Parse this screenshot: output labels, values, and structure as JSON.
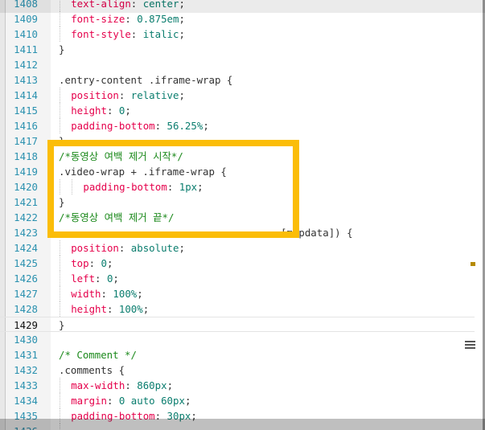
{
  "editor": {
    "language": "css",
    "current_line": "1429",
    "colors": {
      "line_number": "#2b91af",
      "property": "#e5004b",
      "value": "#0a7d6e",
      "comment": "#1d8a1d",
      "highlight_box": "#fbbd08"
    }
  },
  "lines": [
    {
      "n": "1408",
      "indent": 1,
      "tokens": [
        {
          "t": "text-align",
          "k": "prop"
        },
        {
          "t": ": ",
          "k": "pun"
        },
        {
          "t": "center",
          "k": "val"
        },
        {
          "t": ";",
          "k": "pun"
        }
      ]
    },
    {
      "n": "1409",
      "indent": 1,
      "tokens": [
        {
          "t": "font-size",
          "k": "prop"
        },
        {
          "t": ": ",
          "k": "pun"
        },
        {
          "t": "0.875em",
          "k": "val"
        },
        {
          "t": ";",
          "k": "pun"
        }
      ]
    },
    {
      "n": "1410",
      "indent": 1,
      "tokens": [
        {
          "t": "font-style",
          "k": "prop"
        },
        {
          "t": ": ",
          "k": "pun"
        },
        {
          "t": "italic",
          "k": "val"
        },
        {
          "t": ";",
          "k": "pun"
        }
      ]
    },
    {
      "n": "1411",
      "indent": 0,
      "tokens": [
        {
          "t": "}",
          "k": "pun"
        }
      ]
    },
    {
      "n": "1412",
      "indent": 0,
      "tokens": []
    },
    {
      "n": "1413",
      "indent": 0,
      "tokens": [
        {
          "t": ".entry-content .iframe-wrap {",
          "k": "sel"
        }
      ]
    },
    {
      "n": "1414",
      "indent": 1,
      "tokens": [
        {
          "t": "position",
          "k": "prop"
        },
        {
          "t": ": ",
          "k": "pun"
        },
        {
          "t": "relative",
          "k": "val"
        },
        {
          "t": ";",
          "k": "pun"
        }
      ]
    },
    {
      "n": "1415",
      "indent": 1,
      "tokens": [
        {
          "t": "height",
          "k": "prop"
        },
        {
          "t": ": ",
          "k": "pun"
        },
        {
          "t": "0",
          "k": "val"
        },
        {
          "t": ";",
          "k": "pun"
        }
      ]
    },
    {
      "n": "1416",
      "indent": 1,
      "tokens": [
        {
          "t": "padding-bottom",
          "k": "prop"
        },
        {
          "t": ": ",
          "k": "pun"
        },
        {
          "t": "56.25%",
          "k": "val"
        },
        {
          "t": ";",
          "k": "pun"
        }
      ]
    },
    {
      "n": "1417",
      "indent": 0,
      "tokens": [
        {
          "t": "}",
          "k": "pun"
        }
      ]
    },
    {
      "n": "1418",
      "indent": 0,
      "tokens": [
        {
          "t": "/*동영상 여백 제거 시작*/",
          "k": "cmt"
        }
      ]
    },
    {
      "n": "1419",
      "indent": 0,
      "tokens": [
        {
          "t": ".video-wrap + .iframe-wrap {",
          "k": "sel"
        }
      ]
    },
    {
      "n": "1420",
      "indent": 2,
      "tokens": [
        {
          "t": "padding-bottom",
          "k": "prop"
        },
        {
          "t": ": ",
          "k": "pun"
        },
        {
          "t": "1px",
          "k": "val"
        },
        {
          "t": ";",
          "k": "pun"
        }
      ]
    },
    {
      "n": "1421",
      "indent": 0,
      "tokens": [
        {
          "t": "}",
          "k": "pun"
        }
      ]
    },
    {
      "n": "1422",
      "indent": 0,
      "tokens": [
        {
          "t": "/*동영상 여백 제거 끝*/",
          "k": "cmt"
        }
      ]
    },
    {
      "n": "1423",
      "indent": 0,
      "tokens": [
        {
          "t": "                                     [mapdata]) {",
          "k": "sel"
        }
      ]
    },
    {
      "n": "1424",
      "indent": 1,
      "tokens": [
        {
          "t": "position",
          "k": "prop"
        },
        {
          "t": ": ",
          "k": "pun"
        },
        {
          "t": "absolute",
          "k": "val"
        },
        {
          "t": ";",
          "k": "pun"
        }
      ]
    },
    {
      "n": "1425",
      "indent": 1,
      "tokens": [
        {
          "t": "top",
          "k": "prop"
        },
        {
          "t": ": ",
          "k": "pun"
        },
        {
          "t": "0",
          "k": "val"
        },
        {
          "t": ";",
          "k": "pun"
        }
      ]
    },
    {
      "n": "1426",
      "indent": 1,
      "tokens": [
        {
          "t": "left",
          "k": "prop"
        },
        {
          "t": ": ",
          "k": "pun"
        },
        {
          "t": "0",
          "k": "val"
        },
        {
          "t": ";",
          "k": "pun"
        }
      ]
    },
    {
      "n": "1427",
      "indent": 1,
      "tokens": [
        {
          "t": "width",
          "k": "prop"
        },
        {
          "t": ": ",
          "k": "pun"
        },
        {
          "t": "100%",
          "k": "val"
        },
        {
          "t": ";",
          "k": "pun"
        }
      ]
    },
    {
      "n": "1428",
      "indent": 1,
      "tokens": [
        {
          "t": "height",
          "k": "prop"
        },
        {
          "t": ": ",
          "k": "pun"
        },
        {
          "t": "100%",
          "k": "val"
        },
        {
          "t": ";",
          "k": "pun"
        }
      ]
    },
    {
      "n": "1429",
      "indent": 0,
      "tokens": [
        {
          "t": "}",
          "k": "pun"
        }
      ]
    },
    {
      "n": "1430",
      "indent": 0,
      "tokens": []
    },
    {
      "n": "1431",
      "indent": 0,
      "tokens": [
        {
          "t": "/* Comment */",
          "k": "cmt"
        }
      ]
    },
    {
      "n": "1432",
      "indent": 0,
      "tokens": [
        {
          "t": ".comments {",
          "k": "sel"
        }
      ]
    },
    {
      "n": "1433",
      "indent": 1,
      "tokens": [
        {
          "t": "max-width",
          "k": "prop"
        },
        {
          "t": ": ",
          "k": "pun"
        },
        {
          "t": "860px",
          "k": "val"
        },
        {
          "t": ";",
          "k": "pun"
        }
      ]
    },
    {
      "n": "1434",
      "indent": 1,
      "tokens": [
        {
          "t": "margin",
          "k": "prop"
        },
        {
          "t": ": ",
          "k": "pun"
        },
        {
          "t": "0 auto 60px",
          "k": "val"
        },
        {
          "t": ";",
          "k": "pun"
        }
      ]
    },
    {
      "n": "1435",
      "indent": 1,
      "tokens": [
        {
          "t": "padding-bottom",
          "k": "prop"
        },
        {
          "t": ": ",
          "k": "pun"
        },
        {
          "t": "30px",
          "k": "val"
        },
        {
          "t": ";",
          "k": "pun"
        }
      ]
    },
    {
      "n": "1436",
      "indent": 1,
      "tokens": []
    }
  ]
}
